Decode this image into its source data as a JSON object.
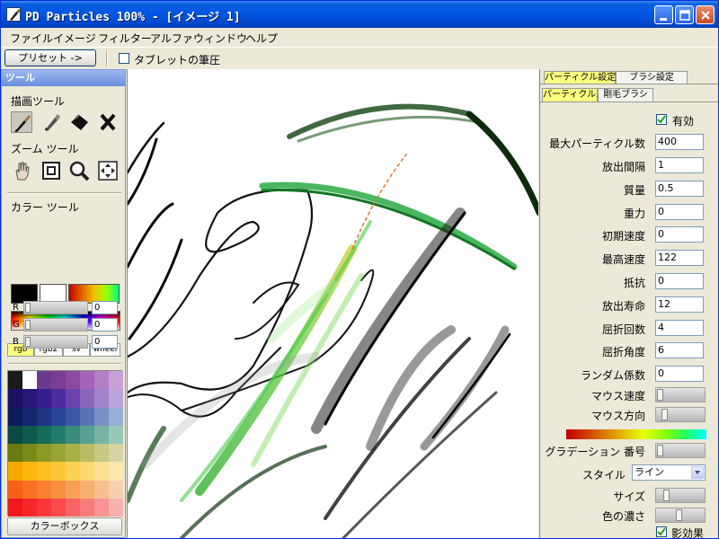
{
  "window": {
    "title": "PD Particles   100%   - [イメージ 1]",
    "icon": "brush-app-icon",
    "controls": [
      "minimize-icon",
      "maximize-icon",
      "close-icon"
    ]
  },
  "menu": [
    "ファイル",
    "イメージ",
    "フィルター",
    "アルファ",
    "ウィンドウ",
    "ヘルプ"
  ],
  "toolbar": {
    "preset_label": "プリセット ->",
    "pressure_label": "タブレットの筆圧",
    "pressure_checked": false
  },
  "tool_panel": {
    "header": "ツール",
    "draw_tools_label": "描画ツール",
    "draw_tools": [
      "brush-icon",
      "pen-icon",
      "fill-icon",
      "eraser-icon"
    ],
    "zoom_tools_label": "ズーム ツール",
    "zoom_tools": [
      "hand-icon",
      "fit-frame-icon",
      "zoom-icon",
      "move-icon"
    ],
    "color_tools_label": "カラー ツール",
    "primary_colors": [
      "#000000",
      "#ffffff"
    ],
    "color_tabs": [
      "rgb",
      "rgb2",
      "sv",
      "wheel"
    ],
    "active_color_tab": "rgb",
    "rgb": {
      "r_label": "R",
      "r_value": "0",
      "g_label": "G",
      "g_value": "0",
      "b_label": "B",
      "b_value": "0"
    },
    "palette": [
      "#1a1a1a",
      "#ffffff",
      "#6b3a8c",
      "#7a3c94",
      "#8a4aa0",
      "#a564b8",
      "#b380c4",
      "#c7a0d4",
      "#1a1064",
      "#26167a",
      "#361e8e",
      "#4d2c9e",
      "#6a44ac",
      "#8866bc",
      "#a084cc",
      "#b8a4d8",
      "#0d1a5c",
      "#14266e",
      "#1c3482",
      "#284494",
      "#3c58a4",
      "#5a72b4",
      "#7890c4",
      "#98aed4",
      "#0a4a40",
      "#0e5a4c",
      "#166a58",
      "#227a68",
      "#3c8c7c",
      "#58a090",
      "#78b4a4",
      "#98c8b8",
      "#6a7a10",
      "#7a8a18",
      "#8a9a24",
      "#9aa634",
      "#aab048",
      "#b8bc64",
      "#c6c884",
      "#d4d4a4",
      "#f8a800",
      "#fcb810",
      "#fcc020",
      "#fcc838",
      "#fcd050",
      "#fcd870",
      "#fce090",
      "#fce8b0",
      "#f86018",
      "#f87020",
      "#f88030",
      "#f89040",
      "#f8a058",
      "#f8b070",
      "#f8c090",
      "#f8d0b0",
      "#f01818",
      "#f42828",
      "#f83838",
      "#f84c4c",
      "#f86464",
      "#f87c7c",
      "#f89494",
      "#f8b0b0"
    ],
    "colorbox_label": "カラーボックス"
  },
  "right_panel": {
    "tabs_top": [
      "パーティクル設定",
      "ブラシ設定"
    ],
    "tabs_sub": [
      "パーティクルス",
      "剛毛ブラシ"
    ],
    "enabled_label": "有効",
    "enabled_checked": true,
    "fields": [
      {
        "label": "最大パーティクル数",
        "value": "400"
      },
      {
        "label": "放出間隔",
        "value": "1"
      },
      {
        "label": "質量",
        "value": "0.5"
      },
      {
        "label": "重力",
        "value": "0"
      },
      {
        "label": "初期速度",
        "value": "0"
      },
      {
        "label": "最高速度",
        "value": "122"
      },
      {
        "label": "抵抗",
        "value": "0"
      },
      {
        "label": "放出寿命",
        "value": "12"
      },
      {
        "label": "屈折回数",
        "value": "4"
      },
      {
        "label": "屈折角度",
        "value": "6"
      },
      {
        "label": "ランダム係数",
        "value": "0"
      }
    ],
    "sliders": [
      {
        "label": "マウス速度",
        "level": 0.0
      },
      {
        "label": "マウス方向",
        "level": 0.1
      }
    ],
    "gradient_label": "グラデーション 番号",
    "gradient_level": 0.0,
    "style_label": "スタイル",
    "style_value": "ライン",
    "size_label": "サイズ",
    "size_level": 0.15,
    "density_label": "色の濃さ",
    "density_level": 0.45,
    "shadow_label": "影効果",
    "shadow_checked": true
  }
}
